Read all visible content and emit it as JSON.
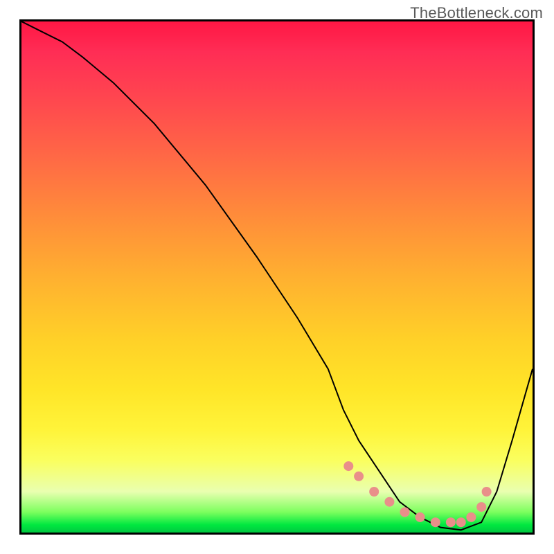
{
  "watermark": "TheBottleneck.com",
  "chart_data": {
    "type": "line",
    "title": "",
    "xlabel": "",
    "ylabel": "",
    "xlim": [
      0,
      100
    ],
    "ylim": [
      0,
      100
    ],
    "grid": false,
    "legend": false,
    "series": [
      {
        "name": "bottleneck-curve",
        "x": [
          0,
          4,
          8,
          12,
          18,
          26,
          36,
          46,
          54,
          60,
          63,
          66,
          70,
          74,
          78,
          82,
          86,
          90,
          93,
          96,
          100
        ],
        "y": [
          100,
          98,
          96,
          93,
          88,
          80,
          68,
          54,
          42,
          32,
          24,
          18,
          12,
          6,
          3,
          1,
          0.5,
          2,
          8,
          18,
          32
        ],
        "stroke": "#000000",
        "stroke_width": 2
      },
      {
        "name": "optimal-band-markers",
        "type": "scatter",
        "x": [
          64,
          66,
          69,
          72,
          75,
          78,
          81,
          84,
          86,
          88,
          90,
          91
        ],
        "y": [
          13,
          11,
          8,
          6,
          4,
          3,
          2,
          2,
          2,
          3,
          5,
          8
        ],
        "marker_color": "#e98f8a",
        "marker_size": 7
      }
    ],
    "background_gradient": {
      "direction": "vertical",
      "stops": [
        {
          "pos": 0.0,
          "color": "#ff1744"
        },
        {
          "pos": 0.5,
          "color": "#ffb030"
        },
        {
          "pos": 0.8,
          "color": "#fff43a"
        },
        {
          "pos": 0.96,
          "color": "#7cff5e"
        },
        {
          "pos": 1.0,
          "color": "#00c840"
        }
      ]
    }
  }
}
